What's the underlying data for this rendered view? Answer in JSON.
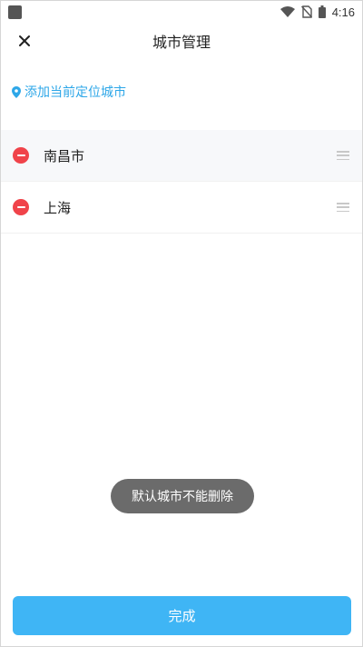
{
  "status_bar": {
    "time": "4:16",
    "icons": [
      "wifi-icon",
      "no-sim-icon",
      "battery-icon"
    ]
  },
  "header": {
    "title": "城市管理",
    "close_icon": "close-icon"
  },
  "add_location": {
    "label": "添加当前定位城市",
    "icon": "location-pin-icon"
  },
  "cities": [
    {
      "name": "南昌市"
    },
    {
      "name": "上海"
    }
  ],
  "toast": {
    "text": "默认城市不能删除"
  },
  "footer": {
    "done_label": "完成"
  },
  "colors": {
    "accent": "#3fb5f5",
    "link": "#2ea7e8",
    "remove": "#f0434a",
    "toast_bg": "#6b6b6b"
  }
}
